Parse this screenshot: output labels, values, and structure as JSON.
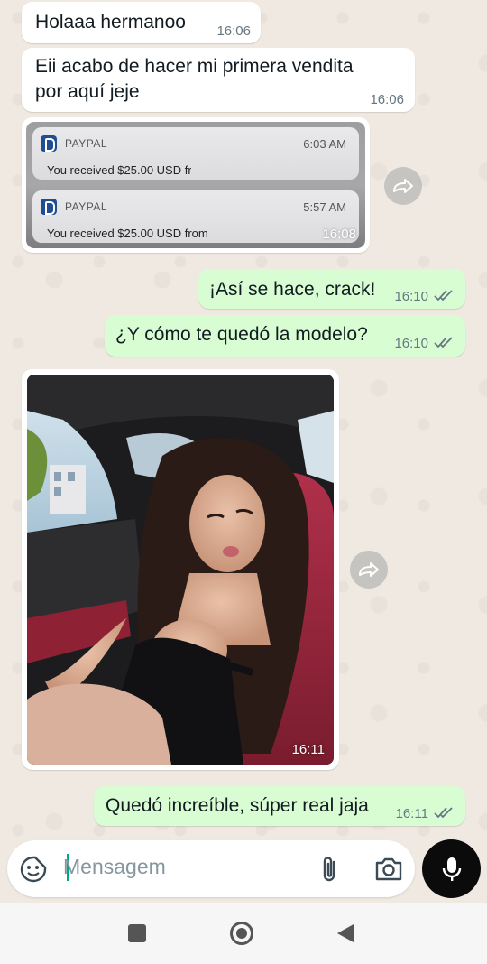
{
  "messages": [
    {
      "text": "Holaaa hermanoo",
      "time": "16:06"
    },
    {
      "text": "Eii acabo de hacer mi primera vendita por aquí jeje",
      "time": "16:06"
    }
  ],
  "paypal": {
    "notifications": [
      {
        "app": "PAYPAL",
        "clock": "6:03 AM",
        "body": "You received $25.00 USD fro"
      },
      {
        "app": "PAYPAL",
        "clock": "5:57 AM",
        "body": "You received $25.00 USD from"
      }
    ],
    "time": "16:08"
  },
  "sent": [
    {
      "text": "¡Así se hace, crack!",
      "time": "16:10"
    },
    {
      "text": "¿Y cómo te quedó la modelo?",
      "time": "16:10"
    },
    {
      "text": "Quedó increíble, súper real jaja",
      "time": "16:11"
    }
  ],
  "photo": {
    "time": "16:11"
  },
  "composer": {
    "placeholder": "Mensagem"
  },
  "colors": {
    "sent_bubble": "#d9fdd3",
    "received_bubble": "#ffffff",
    "read_ticks": "#667781",
    "mic_button": "#0b0b0b"
  }
}
